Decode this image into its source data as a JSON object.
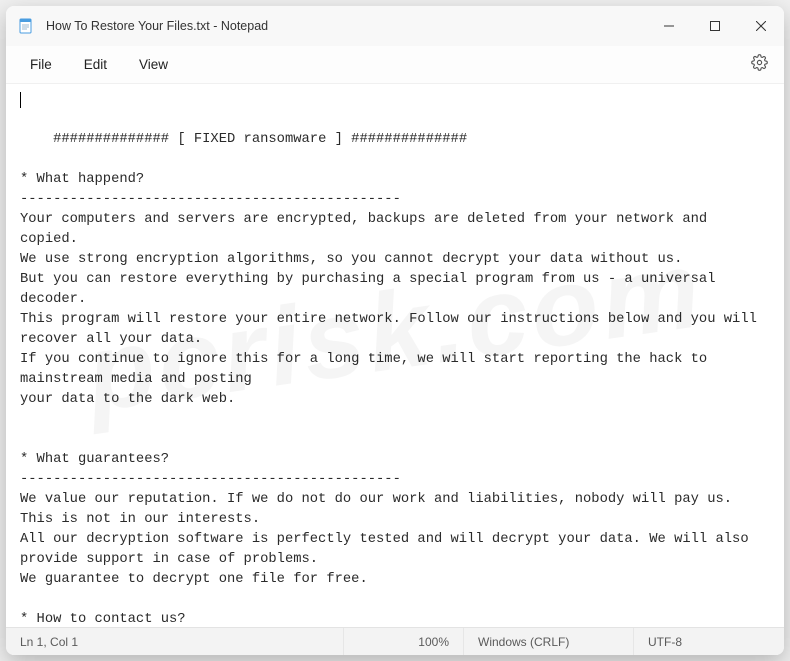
{
  "titlebar": {
    "title": "How To Restore Your Files.txt - Notepad"
  },
  "menubar": {
    "file": "File",
    "edit": "Edit",
    "view": "View"
  },
  "content": {
    "text": "############## [ FIXED ransomware ] ##############\n\n* What happend?\n----------------------------------------------\nYour computers and servers are encrypted, backups are deleted from your network and copied.\nWe use strong encryption algorithms, so you cannot decrypt your data without us.\nBut you can restore everything by purchasing a special program from us - a universal decoder.\nThis program will restore your entire network. Follow our instructions below and you will recover all your data.\nIf you continue to ignore this for a long time, we will start reporting the hack to mainstream media and posting\nyour data to the dark web.\n\n\n* What guarantees?\n----------------------------------------------\nWe value our reputation. If we do not do our work and liabilities, nobody will pay us. This is not in our interests.\nAll our decryption software is perfectly tested and will decrypt your data. We will also provide support in case of problems.\nWe guarantee to decrypt one file for free.\n\n* How to contact us?\n----------------------------------------------\nmrbroock@msgsafe.io"
  },
  "statusbar": {
    "position": "Ln 1, Col 1",
    "zoom": "100%",
    "line_ending": "Windows (CRLF)",
    "encoding": "UTF-8"
  },
  "watermark": "pcrisk.com"
}
